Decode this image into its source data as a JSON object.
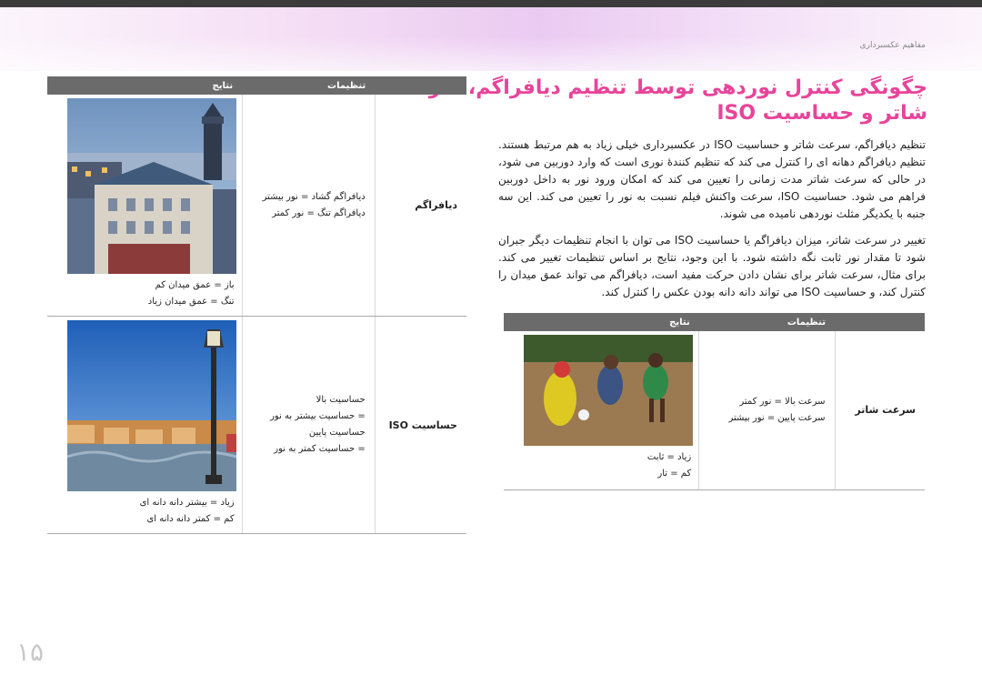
{
  "breadcrumb": "مفاهیم عکسبرداری",
  "title": {
    "line1": "چگونگی کنترل نوردهی توسط تنظیم دیافراگم، سرعت",
    "line2": "شاتر و حساسیت ISO"
  },
  "paragraph1": "تنظیم دیافراگم، سرعت شاتر و حساسیت ISO در عکسبرداری خیلی زیاد به هم مرتبط هستند. تنظیم دیافراگم دهانه ای را کنترل می کند که تنظیم کنندهٔ نوری است که وارد دوربین می شود، در حالی که سرعت شاتر مدت زمانی را تعیین می کند که امکان ورود نور به داخل دوربین فراهم می شود. حساسیت ISO، سرعت واکنش فیلم نسبت به نور را تعیین می کند. این سه جنبه با یکدیگر مثلث نوردهی نامیده می شوند.",
  "paragraph2": "تغییر در سرعت شاتر، میزان دیافراگم یا حساسیت ISO می توان با انجام تنظیمات دیگر جبران شود تا مقدار نور ثابت نگه داشته شود. با این وجود، نتایج بر اساس تنظیمات تغییر می کند. برای مثال، سرعت شاتر برای نشان دادن حرکت مفید است، دیافراگم می تواند عمق میدان را کنترل کند، و حساسیت ISO می تواند دانه دانه بودن عکس را کنترل کند.",
  "left_table": {
    "headers": {
      "settings": "تنظیمات",
      "results": "نتایج"
    },
    "rows": [
      {
        "feature": "دیافراگم",
        "desc": [
          "دیافراگم گشاد = نور بیشتر",
          "دیافراگم تنگ = نور کمتر"
        ],
        "captions": [
          "باز = عمق میدان کم",
          "تنگ = عمق میدان زیاد"
        ]
      },
      {
        "feature": "حساسیت ISO",
        "desc": [
          "حساسیت بالا",
          "= حساسیت بیشتر به نور",
          "حساسیت پایین",
          "= حساسیت کمتر به نور"
        ],
        "captions": [
          "زیاد = بیشتر دانه دانه ای",
          "کم = کمتر دانه دانه ای"
        ]
      }
    ]
  },
  "right_table": {
    "headers": {
      "settings": "تنظیمات",
      "results": "نتایج"
    },
    "rows": [
      {
        "feature": "سرعت شاتر",
        "desc": [
          "سرعت بالا = نور کمتر",
          "سرعت پایین = نور بیشتر"
        ],
        "captions": [
          "زیاد = ثابت",
          "کم = تار"
        ]
      }
    ]
  },
  "page_number": "۱۵",
  "colors": {
    "title": "#e8449a",
    "table_header": "#6b6b6b",
    "top_bar": "#3b3b3b"
  }
}
